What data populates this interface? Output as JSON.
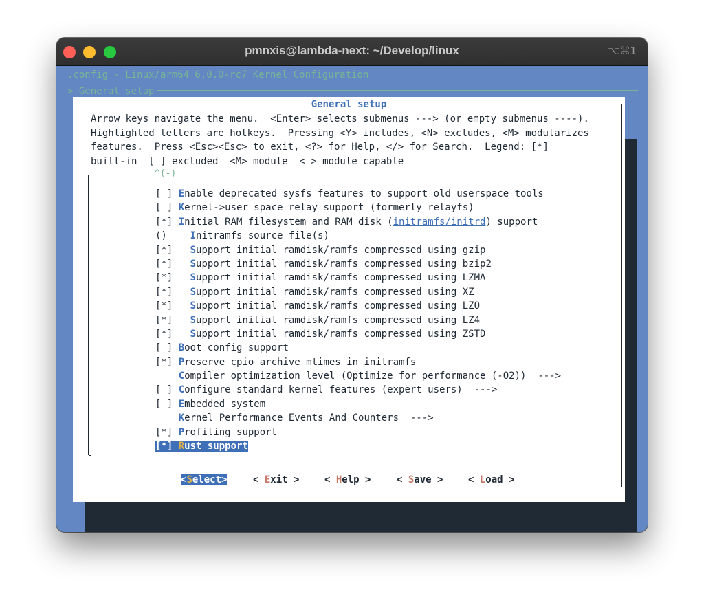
{
  "window": {
    "title": "pmnxis@lambda-next: ~/Develop/linux",
    "shortcut": "⌥⌘1"
  },
  "terminal": {
    "backtitle": ".config - Linux/arm64 6.0.0-rc7 Kernel Configuration",
    "breadcrumb": "> General setup"
  },
  "dialog": {
    "title": "General setup",
    "help_lines": [
      "Arrow keys navigate the menu.  <Enter> selects submenus ---> (or empty submenus ----).",
      "Highlighted letters are hotkeys.  Pressing <Y> includes, <N> excludes, <M> modularizes",
      "features.  Press <Esc><Esc> to exit, <?> for Help, </> for Search.  Legend: [*]",
      "built-in  [ ] excluded  <M> module  < > module capable"
    ],
    "scroll_indicator": "^(-)",
    "items": [
      {
        "prefix": "[ ] ",
        "hotkey": "E",
        "rest": "nable deprecated sysfs features to support old userspace tools"
      },
      {
        "prefix": "[ ] ",
        "hotkey": "K",
        "rest": "ernel->user space relay support (formerly relayfs)"
      },
      {
        "prefix": "[*] ",
        "hotkey": "I",
        "rest": "nitial RAM filesystem and RAM disk (",
        "link": "initramfs/initrd",
        "after": ") support"
      },
      {
        "prefix": "()    ",
        "hotkey": "I",
        "rest": "nitramfs source file(s)"
      },
      {
        "prefix": "[*]   ",
        "hotkey": "S",
        "rest": "upport initial ramdisk/ramfs compressed using gzip"
      },
      {
        "prefix": "[*]   ",
        "hotkey": "S",
        "rest": "upport initial ramdisk/ramfs compressed using bzip2"
      },
      {
        "prefix": "[*]   ",
        "hotkey": "S",
        "rest": "upport initial ramdisk/ramfs compressed using LZMA"
      },
      {
        "prefix": "[*]   ",
        "hotkey": "S",
        "rest": "upport initial ramdisk/ramfs compressed using XZ"
      },
      {
        "prefix": "[*]   ",
        "hotkey": "S",
        "rest": "upport initial ramdisk/ramfs compressed using LZO"
      },
      {
        "prefix": "[*]   ",
        "hotkey": "S",
        "rest": "upport initial ramdisk/ramfs compressed using LZ4"
      },
      {
        "prefix": "[*]   ",
        "hotkey": "S",
        "rest": "upport initial ramdisk/ramfs compressed using ZSTD"
      },
      {
        "prefix": "[ ] ",
        "hotkey": "B",
        "rest": "oot config support"
      },
      {
        "prefix": "[*] ",
        "hotkey": "P",
        "rest": "reserve cpio archive mtimes in initramfs"
      },
      {
        "prefix": "    ",
        "hotkey": "C",
        "rest": "ompiler optimization level (Optimize for performance (-O2))  --->"
      },
      {
        "prefix": "[ ] ",
        "hotkey": "C",
        "rest": "onfigure standard kernel features (expert users)  --->"
      },
      {
        "prefix": "[ ] ",
        "hotkey": "E",
        "rest": "mbedded system"
      },
      {
        "prefix": "    ",
        "hotkey": "K",
        "rest": "ernel Performance Events And Counters  --->"
      },
      {
        "prefix": "[*] ",
        "hotkey": "P",
        "rest": "rofiling support"
      },
      {
        "prefix": "[*] ",
        "hotkey": "R",
        "rest": "ust support",
        "selected": true
      }
    ],
    "buttons": [
      {
        "open": "<",
        "hotkey": "S",
        "rest": "elect",
        "close": ">",
        "active": true
      },
      {
        "open": "< ",
        "hotkey": "E",
        "rest": "xit",
        "close": " >"
      },
      {
        "open": "< ",
        "hotkey": "H",
        "rest": "elp",
        "close": " >"
      },
      {
        "open": "< ",
        "hotkey": "S",
        "rest": "ave",
        "close": " >"
      },
      {
        "open": "< ",
        "hotkey": "L",
        "rest": "oad",
        "close": " >"
      }
    ]
  },
  "colors": {
    "terminal_bg": "#6287c2",
    "dialog_bg": "#ffffff",
    "accent": "#3f6fb6",
    "dim_text": "#78b596",
    "highlight_hotkey": "#e0b14c"
  }
}
